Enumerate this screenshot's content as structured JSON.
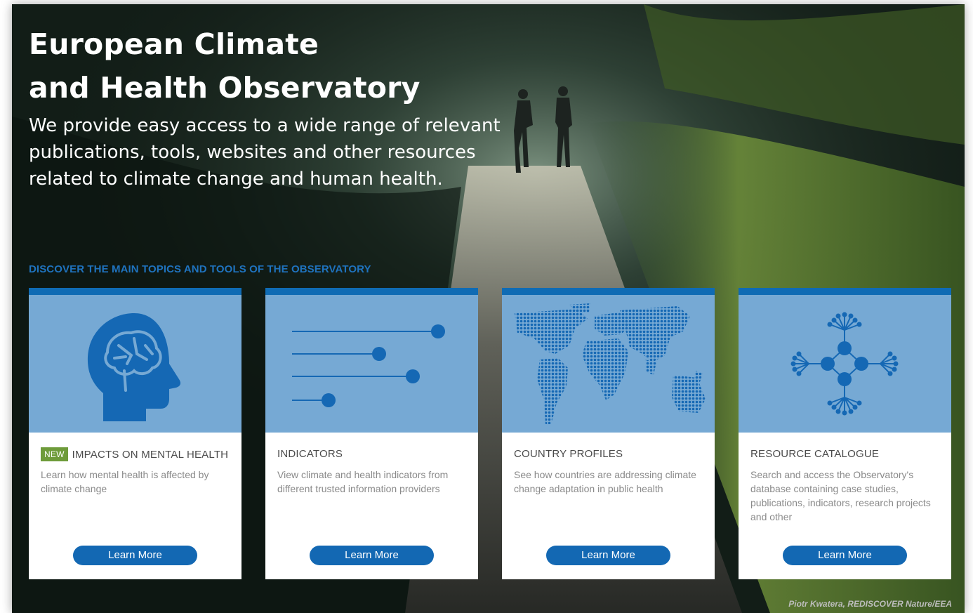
{
  "hero": {
    "title_line1": "European Climate",
    "title_line2": "and Health Observatory",
    "subtitle_line1": "We provide easy access to a wide range of relevant",
    "subtitle_line2": "publications, tools, websites and other resources",
    "subtitle_line3": "related to climate change and human health."
  },
  "discover_label": "DISCOVER THE MAIN TOPICS AND TOOLS OF THE OBSERVATORY",
  "cards": [
    {
      "icon": "brain-head-icon",
      "badge": "NEW",
      "title": "IMPACTS ON MENTAL HEALTH",
      "description": "Learn how mental health is affected by climate change",
      "button": "Learn More"
    },
    {
      "icon": "indicator-sliders-icon",
      "title": "INDICATORS",
      "description": "View climate and health indicators from different trusted information providers",
      "button": "Learn More"
    },
    {
      "icon": "dotted-world-map-icon",
      "title": "COUNTRY PROFILES",
      "description": "See how countries are addressing climate change adaptation in public health",
      "button": "Learn More"
    },
    {
      "icon": "network-nodes-icon",
      "title": "RESOURCE CATALOGUE",
      "description": "Search and access the Observatory's database containing case studies, publications, indicators, research projects and other",
      "button": "Learn More"
    }
  ],
  "photo_credit": "Piotr Kwatera, REDISCOVER Nature/EEA",
  "colors": {
    "accent_blue": "#1368b3",
    "card_topbar": "#0f6bb4",
    "illustration_bg": "#76a9d4",
    "icon_blue": "#1568b4",
    "badge_green": "#6e9b3a"
  }
}
